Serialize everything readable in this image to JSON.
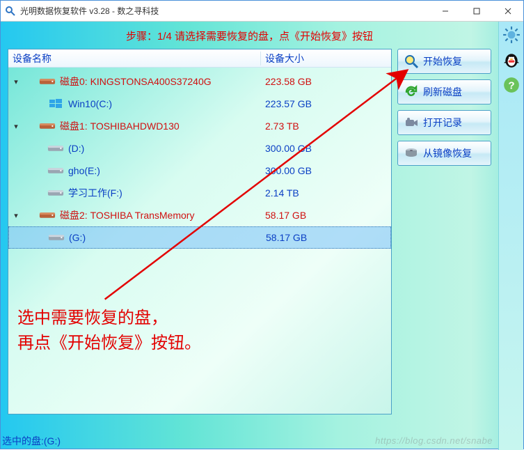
{
  "window": {
    "title": "光明数据恢复软件 v3.28 - 数之寻科技"
  },
  "step_header": "步骤：1/4 请选择需要恢复的盘，点《开始恢复》按钮",
  "columns": {
    "name": "设备名称",
    "size": "设备大小"
  },
  "tree": [
    {
      "type": "disk",
      "expanded": true,
      "label": "磁盘0: KINGSTONSA400S37240G",
      "size": "223.58 GB",
      "children": [
        {
          "type": "part",
          "os": true,
          "label": "Win10(C:)",
          "size": "223.57 GB"
        }
      ]
    },
    {
      "type": "disk",
      "expanded": true,
      "label": "磁盘1: TOSHIBAHDWD130",
      "size": "2.73 TB",
      "children": [
        {
          "type": "part",
          "label": "(D:)",
          "size": "300.00 GB"
        },
        {
          "type": "part",
          "label": "gho(E:)",
          "size": "300.00 GB"
        },
        {
          "type": "part",
          "label": "学习工作(F:)",
          "size": "2.14 TB"
        }
      ]
    },
    {
      "type": "disk",
      "expanded": true,
      "label": "磁盘2: TOSHIBA  TransMemory",
      "size": "58.17 GB",
      "children": [
        {
          "type": "part",
          "label": "(G:)",
          "size": "58.17 GB",
          "selected": true
        }
      ]
    }
  ],
  "buttons": {
    "start": "开始恢复",
    "refresh": "刷新磁盘",
    "openlog": "打开记录",
    "fromimage": "从镜像恢复"
  },
  "annotation": {
    "line1": "选中需要恢复的盘，",
    "line2": "再点《开始恢复》按钮。"
  },
  "status": "选中的盘:(G:)",
  "watermark": "https://blog.csdn.net/snabe"
}
